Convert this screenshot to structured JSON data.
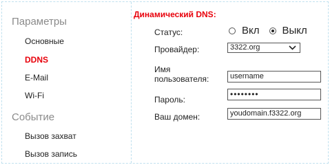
{
  "sidebar": {
    "sections": [
      {
        "title": "Параметры",
        "items": [
          {
            "label": "Основные",
            "active": false
          },
          {
            "label": "DDNS",
            "active": true
          },
          {
            "label": "E-Mail",
            "active": false
          },
          {
            "label": "Wi-Fi",
            "active": false
          }
        ]
      },
      {
        "title": "Событие",
        "items": [
          {
            "label": "Вызов захват",
            "active": false
          },
          {
            "label": "Вызов запись",
            "active": false
          }
        ]
      }
    ]
  },
  "ddns": {
    "title": "Динамический DNS:",
    "status_label": "Статус:",
    "status_options": [
      "Вкл",
      "Выкл"
    ],
    "status_selected": "Выкл",
    "provider_label": "Провайдер:",
    "provider_value": "3322.org",
    "username_label_line1": "Имя",
    "username_label_line2": "пользователя:",
    "username_value": "username",
    "password_label": "Пароль:",
    "password_mask": "••••••••",
    "domain_label": "Ваш домен:",
    "domain_value": "youdomain.f3322.org"
  },
  "colors": {
    "accent": "#e8000b",
    "section_title": "#8a8a8a",
    "border": "#bfe0ee"
  }
}
